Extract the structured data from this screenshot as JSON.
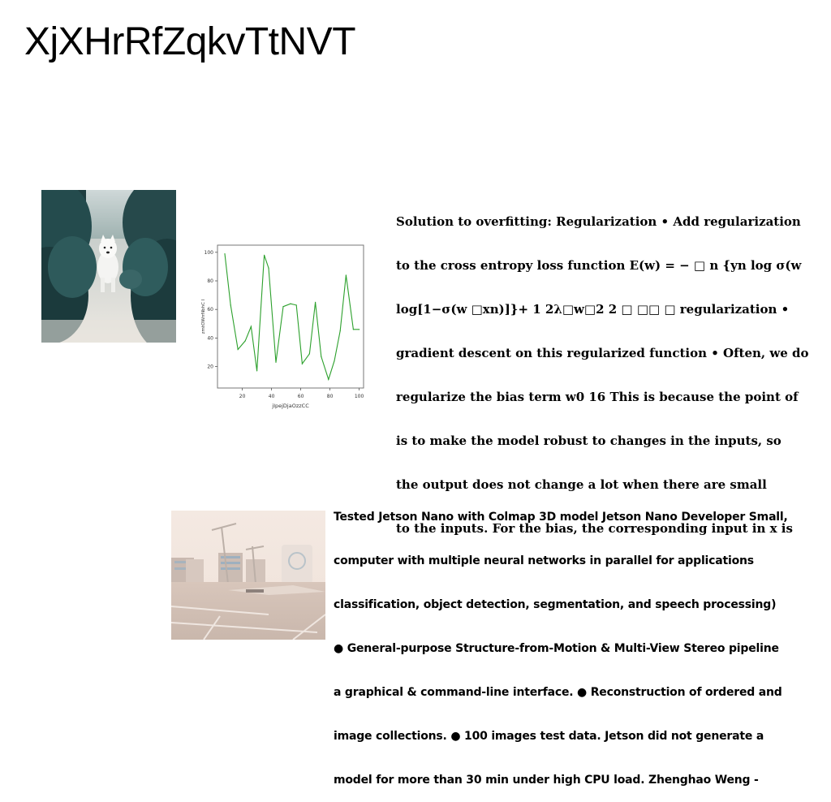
{
  "page": {
    "title": "XjXHrRfZqkvTtNVT"
  },
  "images": {
    "dog_photo": "white dog on snowy path between dark green hedges",
    "city_photo": "pale plaza with street lamps and modern buildings"
  },
  "paragraph_1": {
    "lines": [
      "Solution to overfitting: Regularization • Add regularization",
      "to the cross entropy loss function E(w) = − □ n {yn log σ(w",
      "log[1−σ(w □xn)]}+ 1 2λ□w□2 2 □ □□ □ regularization •",
      "gradient descent on this regularized function • Often, we do",
      "regularize the bias term w0 16 This is because the point of",
      "is to make the model robust to changes in the inputs, so",
      "the output does not change a lot when there are small",
      "to the inputs. For the bias, the corresponding input in x is"
    ]
  },
  "paragraph_2": {
    "lines": [
      "Tested Jetson Nano with Colmap 3D model Jetson Nano Developer Small,",
      "computer with multiple neural networks in parallel for applications",
      "classification, object detection, segmentation, and speech processing)",
      "● General-purpose Structure-from-Motion & Multi-View Stereo pipeline",
      "a graphical & command-line interface. ● Reconstruction of ordered and",
      "image collections. ● 100 images test data. Jetson did not generate a",
      "model for more than 30 min under high CPU load. Zhenghao Weng -"
    ]
  },
  "chart_data": {
    "type": "line",
    "title": "",
    "xlabel": "jIpejDjaOzzCC",
    "ylabel": "zmtOWrrNbhC I",
    "xlim": [
      3,
      103
    ],
    "ylim": [
      5,
      105
    ],
    "xticks": [
      20,
      40,
      60,
      80,
      100
    ],
    "yticks": [
      20,
      40,
      60,
      80,
      100
    ],
    "grid": false,
    "series": [
      {
        "color": "#2ca02c",
        "x": [
          8,
          12,
          17,
          22,
          26,
          30,
          35,
          38,
          43,
          48,
          53,
          57,
          61,
          66,
          70,
          74,
          79,
          83,
          87,
          91,
          96,
          100
        ],
        "y": [
          99,
          63,
          32,
          38,
          48,
          17,
          98,
          89,
          23,
          62,
          64,
          63,
          22,
          29,
          65,
          27,
          11,
          24,
          45,
          84,
          46,
          46
        ]
      }
    ]
  }
}
